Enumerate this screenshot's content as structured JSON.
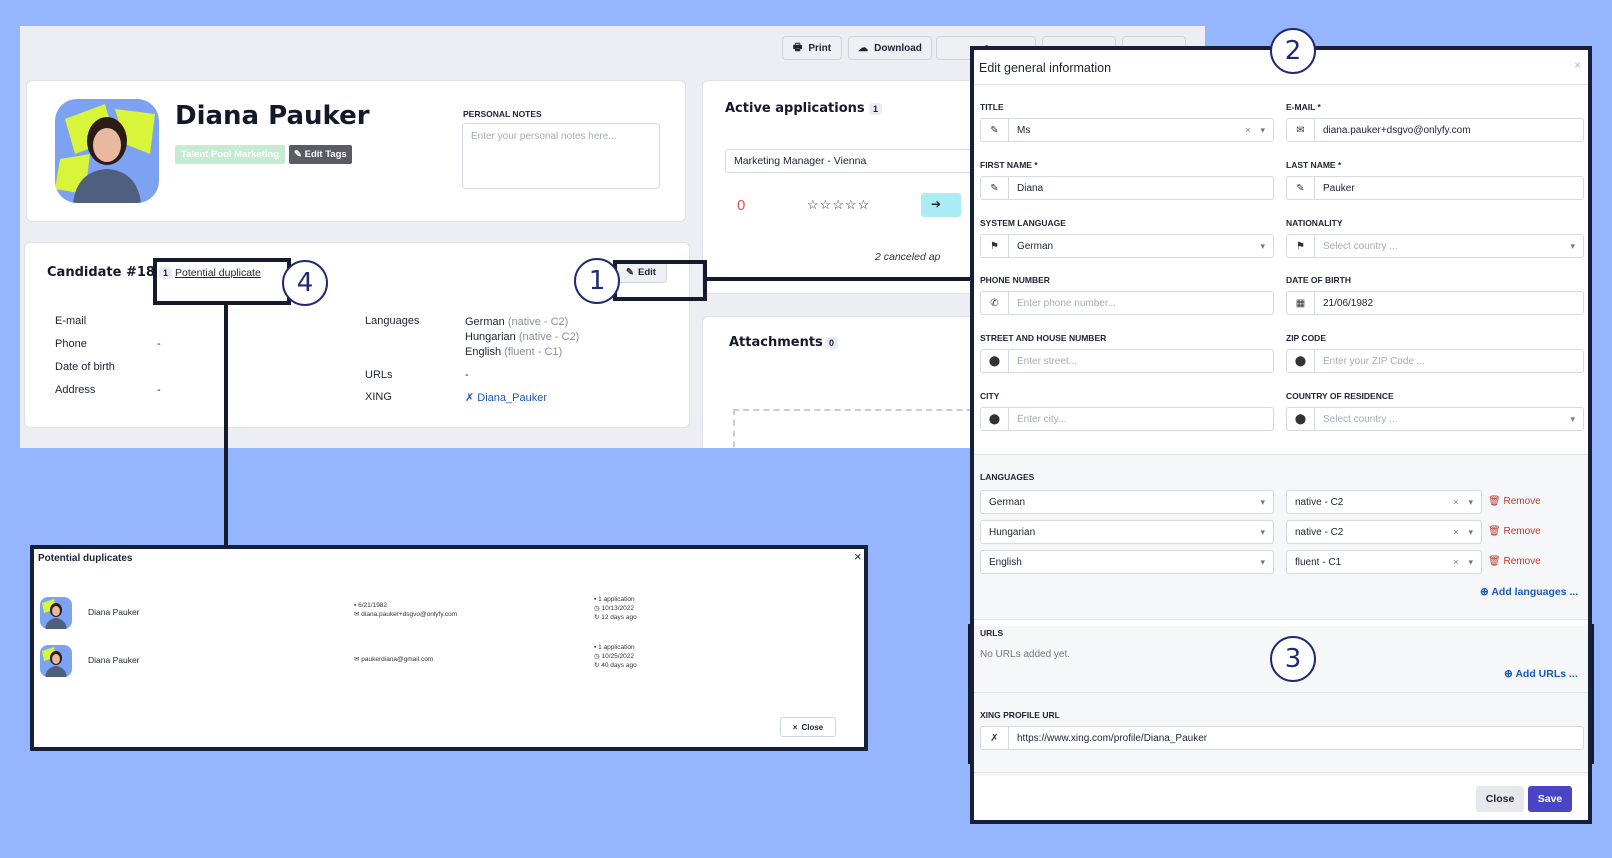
{
  "toolbar": {
    "print": "Print",
    "download": "Download"
  },
  "profile": {
    "name": "Diana Pauker",
    "tag": "Talent Pool Marketing",
    "edit_tags": "Edit Tags",
    "notes_label": "PERSONAL NOTES",
    "notes_placeholder": "Enter your personal notes here..."
  },
  "candidate": {
    "title": "Candidate #18",
    "dup_count": "1",
    "dup_link": "Potential duplicate",
    "edit": "Edit",
    "fields": [
      {
        "label": "E-mail",
        "value": ""
      },
      {
        "label": "Phone",
        "value": "-"
      },
      {
        "label": "Date of birth",
        "value": ""
      },
      {
        "label": "Address",
        "value": "-"
      }
    ],
    "languages_label": "Languages",
    "languages": [
      {
        "name": "German",
        "level": "(native - C2)"
      },
      {
        "name": "Hungarian",
        "level": "(native - C2)"
      },
      {
        "name": "English",
        "level": "(fluent - C1)"
      }
    ],
    "urls_label": "URLs",
    "urls_value": "-",
    "xing_label": "XING",
    "xing_value": "Diana_Pauker"
  },
  "applications": {
    "title": "Active applications",
    "count": "1",
    "job": "Marketing Manager - Vienna",
    "score": "0",
    "rating": 0,
    "canceled": "2 canceled ap"
  },
  "attachments": {
    "title": "Attachments",
    "count": "0"
  },
  "callouts": [
    "1",
    "2",
    "3",
    "4"
  ],
  "modal": {
    "title": "Edit general information",
    "title_label": "TITLE",
    "title_value": "Ms",
    "email_label": "E-MAIL *",
    "email_value": "diana.pauker+dsgvo@onlyfy.com",
    "first_label": "FIRST NAME *",
    "first_value": "Diana",
    "last_label": "LAST NAME *",
    "last_value": "Pauker",
    "syslang_label": "SYSTEM LANGUAGE",
    "syslang_value": "German",
    "nationality_label": "NATIONALITY",
    "nationality_ph": "Select country ...",
    "phone_label": "PHONE NUMBER",
    "phone_ph": "Enter phone number...",
    "dob_label": "DATE OF BIRTH",
    "dob_value": "21/06/1982",
    "street_label": "STREET AND HOUSE NUMBER",
    "street_ph": "Enter street...",
    "zip_label": "ZIP CODE",
    "zip_ph": "Enter your ZIP Code ...",
    "city_label": "CITY",
    "city_ph": "Enter city...",
    "residence_label": "COUNTRY OF RESIDENCE",
    "residence_ph": "Select country ...",
    "languages_label": "LANGUAGES",
    "languages": [
      {
        "name": "German",
        "level": "native - C2"
      },
      {
        "name": "Hungarian",
        "level": "native - C2"
      },
      {
        "name": "English",
        "level": "fluent - C1"
      }
    ],
    "remove": "Remove",
    "add_languages": "Add languages ...",
    "urls_label": "URLS",
    "no_urls": "No URLs added yet.",
    "add_urls": "Add URLs ...",
    "xing_label": "XING PROFILE URL",
    "xing_value": "https://www.xing.com/profile/Diana_Pauker",
    "close": "Close",
    "save": "Save"
  },
  "duplicates": {
    "title": "Potential duplicates",
    "rows": [
      {
        "name": "Diana Pauker",
        "dob": "6/21/1982",
        "email": "diana.pauker+dsgvo@onlyfy.com",
        "apps": "1 application",
        "date": "10/13/2022",
        "ago": "12 days ago"
      },
      {
        "name": "Diana Pauker",
        "dob": "",
        "email": "paukerdiana@gmail.com",
        "apps": "1 application",
        "date": "10/25/2022",
        "ago": "40 days ago"
      }
    ],
    "close": "Close"
  }
}
